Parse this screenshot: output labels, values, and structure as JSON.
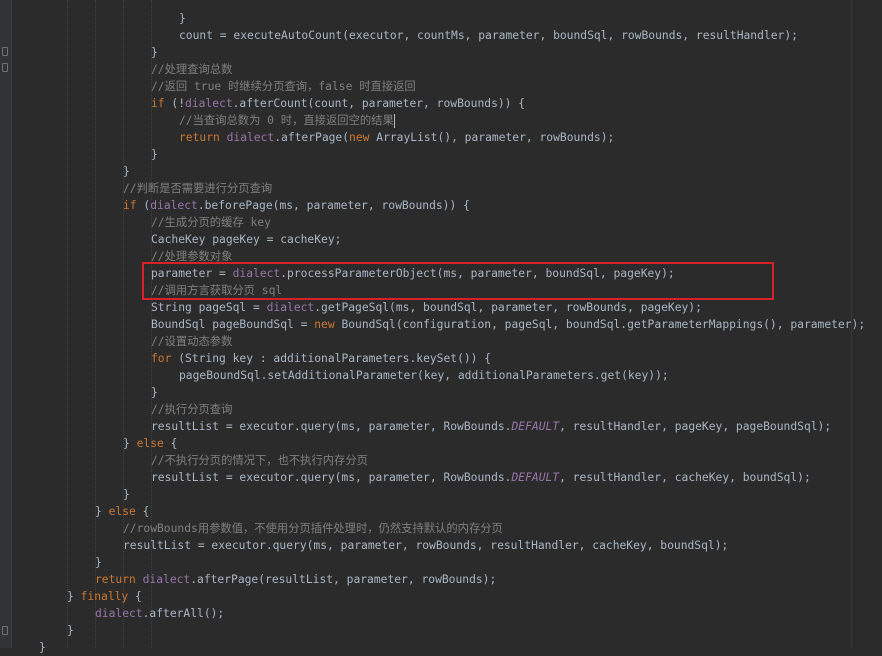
{
  "editor": {
    "lines": [
      {
        "indent": 0,
        "tokens": [
          {
            "t": "}",
            "c": "pl"
          }
        ]
      },
      {
        "indent": 0,
        "tokens": [
          {
            "t": "count = executeAutoCount(executor, countMs, parameter, boundSql, rowBounds, resultHandler);",
            "c": "pl"
          }
        ]
      },
      {
        "indent": 0,
        "tokens": [
          {
            "t": "}",
            "c": "pl"
          }
        ]
      },
      {
        "indent": 0,
        "tokens": [
          {
            "t": "//处理查询总数",
            "c": "cm"
          }
        ]
      },
      {
        "indent": 0,
        "tokens": [
          {
            "t": "//返回 true 时继续分页查询，false 时直接返回",
            "c": "cm"
          }
        ]
      },
      {
        "indent": 0,
        "tokens": [
          {
            "t": "if ",
            "c": "kw"
          },
          {
            "t": "(!",
            "c": "pl"
          },
          {
            "t": "dialect",
            "c": "fld"
          },
          {
            "t": ".afterCount(count, parameter, rowBounds)) {",
            "c": "pl"
          }
        ]
      },
      {
        "indent": 0,
        "tokens": [
          {
            "t": "//当查询总数为 0 时，直接返回空的结果",
            "c": "cm"
          }
        ]
      },
      {
        "indent": 0,
        "tokens": [
          {
            "t": "return ",
            "c": "kw"
          },
          {
            "t": "dialect",
            "c": "fld"
          },
          {
            "t": ".afterPage(",
            "c": "pl"
          },
          {
            "t": "new ",
            "c": "kw"
          },
          {
            "t": "ArrayList(), parameter, rowBounds);",
            "c": "pl"
          }
        ]
      },
      {
        "indent": 0,
        "tokens": [
          {
            "t": "}",
            "c": "pl"
          }
        ]
      },
      {
        "indent": 0,
        "tokens": [
          {
            "t": "}",
            "c": "pl"
          }
        ]
      },
      {
        "indent": 0,
        "tokens": [
          {
            "t": "//判断是否需要进行分页查询",
            "c": "cm"
          }
        ]
      },
      {
        "indent": 0,
        "tokens": [
          {
            "t": "if ",
            "c": "kw"
          },
          {
            "t": "(",
            "c": "pl"
          },
          {
            "t": "dialect",
            "c": "fld"
          },
          {
            "t": ".beforePage(ms, parameter, rowBounds)) {",
            "c": "pl"
          }
        ]
      },
      {
        "indent": 0,
        "tokens": [
          {
            "t": "//生成分页的缓存 key",
            "c": "cm"
          }
        ]
      },
      {
        "indent": 0,
        "tokens": [
          {
            "t": "CacheKey pageKey = cacheKey;",
            "c": "pl"
          }
        ]
      },
      {
        "indent": 0,
        "tokens": [
          {
            "t": "//处理参数对象",
            "c": "cm"
          }
        ]
      },
      {
        "indent": 0,
        "tokens": [
          {
            "t": "parameter = ",
            "c": "pl"
          },
          {
            "t": "dialect",
            "c": "fld"
          },
          {
            "t": ".processParameterObject(ms, parameter, boundSql, pageKey);",
            "c": "pl"
          }
        ]
      },
      {
        "indent": 0,
        "tokens": [
          {
            "t": "//调用方言获取分页 sql",
            "c": "cm"
          }
        ]
      },
      {
        "indent": 0,
        "tokens": [
          {
            "t": "String pageSql = ",
            "c": "pl"
          },
          {
            "t": "dialect",
            "c": "fld"
          },
          {
            "t": ".getPageSql(ms, boundSql, parameter, rowBounds, pageKey);",
            "c": "pl"
          }
        ]
      },
      {
        "indent": 0,
        "tokens": [
          {
            "t": "BoundSql pageBoundSql = ",
            "c": "pl"
          },
          {
            "t": "new ",
            "c": "kw"
          },
          {
            "t": "BoundSql(configuration, pageSql, boundSql.getParameterMappings(), parameter);",
            "c": "pl"
          }
        ]
      },
      {
        "indent": 0,
        "tokens": [
          {
            "t": "//设置动态参数",
            "c": "cm"
          }
        ]
      },
      {
        "indent": 0,
        "tokens": [
          {
            "t": "for ",
            "c": "kw"
          },
          {
            "t": "(String key : additionalParameters.keySet()) {",
            "c": "pl"
          }
        ]
      },
      {
        "indent": 0,
        "tokens": [
          {
            "t": "pageBoundSql.setAdditionalParameter(key, additionalParameters.get(key));",
            "c": "pl"
          }
        ]
      },
      {
        "indent": 0,
        "tokens": [
          {
            "t": "}",
            "c": "pl"
          }
        ]
      },
      {
        "indent": 0,
        "tokens": [
          {
            "t": "//执行分页查询",
            "c": "cm"
          }
        ]
      },
      {
        "indent": 0,
        "tokens": [
          {
            "t": "resultList = executor.query(ms, parameter, RowBounds.",
            "c": "pl"
          },
          {
            "t": "DEFAULT",
            "c": "cst"
          },
          {
            "t": ", resultHandler, pageKey, pageBoundSql);",
            "c": "pl"
          }
        ]
      },
      {
        "indent": 0,
        "tokens": [
          {
            "t": "} ",
            "c": "pl"
          },
          {
            "t": "else ",
            "c": "kw"
          },
          {
            "t": "{",
            "c": "pl"
          }
        ]
      },
      {
        "indent": 0,
        "tokens": [
          {
            "t": "//不执行分页的情况下，也不执行内存分页",
            "c": "cm"
          }
        ]
      },
      {
        "indent": 0,
        "tokens": [
          {
            "t": "resultList = executor.query(ms, parameter, RowBounds.",
            "c": "pl"
          },
          {
            "t": "DEFAULT",
            "c": "cst"
          },
          {
            "t": ", resultHandler, cacheKey, boundSql);",
            "c": "pl"
          }
        ]
      },
      {
        "indent": 0,
        "tokens": [
          {
            "t": "}",
            "c": "pl"
          }
        ]
      },
      {
        "indent": 0,
        "tokens": [
          {
            "t": "} ",
            "c": "pl"
          },
          {
            "t": "else ",
            "c": "kw"
          },
          {
            "t": "{",
            "c": "pl"
          }
        ]
      },
      {
        "indent": 0,
        "tokens": [
          {
            "t": "//rowBounds用参数值，不使用分页插件处理时，仍然支持默认的内存分页",
            "c": "cm"
          }
        ]
      },
      {
        "indent": 0,
        "tokens": [
          {
            "t": "resultList = executor.query(ms, parameter, rowBounds, resultHandler, cacheKey, boundSql);",
            "c": "pl"
          }
        ]
      },
      {
        "indent": 0,
        "tokens": [
          {
            "t": "}",
            "c": "pl"
          }
        ]
      },
      {
        "indent": 0,
        "tokens": [
          {
            "t": "return ",
            "c": "kw"
          },
          {
            "t": "dialect",
            "c": "fld"
          },
          {
            "t": ".afterPage(resultList, parameter, rowBounds);",
            "c": "pl"
          }
        ]
      },
      {
        "indent": 0,
        "tokens": [
          {
            "t": "} ",
            "c": "pl"
          },
          {
            "t": "finally ",
            "c": "kw"
          },
          {
            "t": "{",
            "c": "pl"
          }
        ]
      },
      {
        "indent": 0,
        "tokens": [
          {
            "t": "dialect",
            "c": "fld"
          },
          {
            "t": ".afterAll();",
            "c": "pl"
          }
        ]
      },
      {
        "indent": 0,
        "tokens": [
          {
            "t": "}",
            "c": "pl"
          }
        ]
      },
      {
        "indent": 0,
        "tokens": [
          {
            "t": "}",
            "c": "pl"
          }
        ]
      }
    ]
  },
  "colors": {
    "background": "#2b2b2b",
    "keyword": "#cc7832",
    "comment": "#808080",
    "field": "#9876aa",
    "plain": "#a9b7c6",
    "highlight_box": "#d7202a"
  }
}
